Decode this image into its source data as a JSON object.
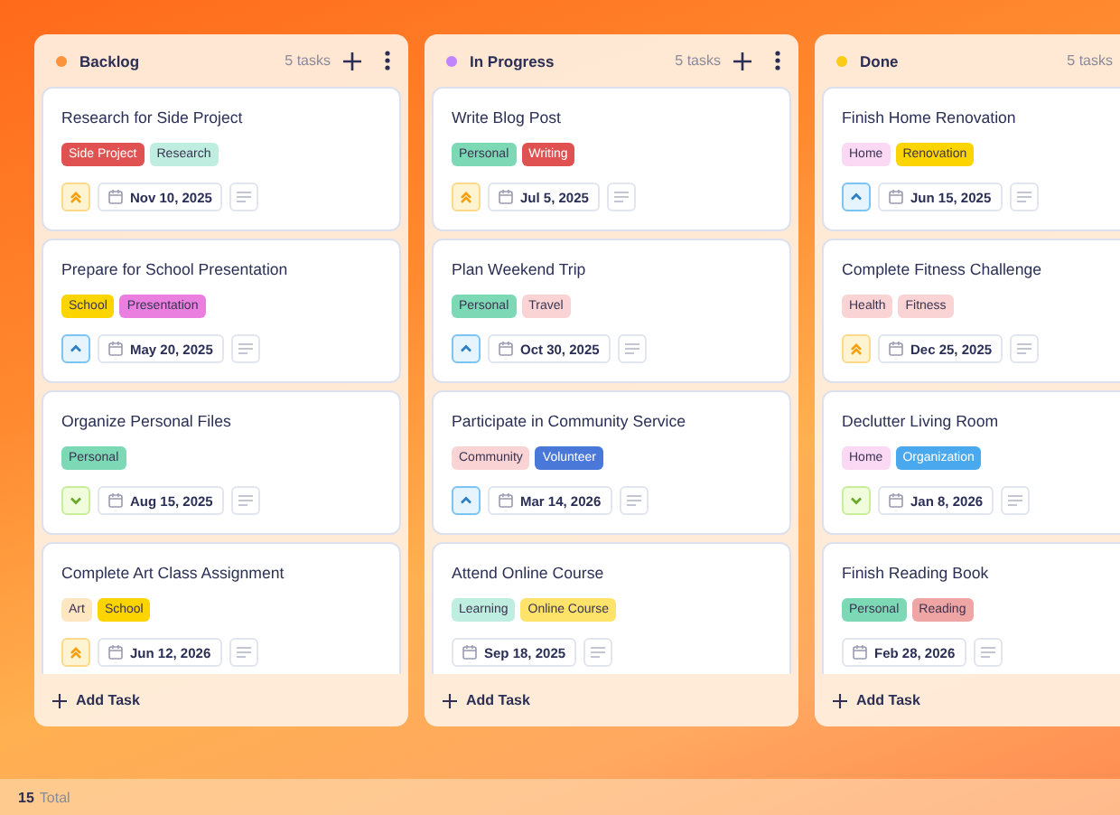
{
  "columns": [
    {
      "title": "Backlog",
      "color": "#fb923c",
      "count": "5 tasks",
      "actions": true,
      "cards": [
        {
          "title": "Research for Side Project",
          "tags": [
            {
              "label": "Side Project",
              "color": "#e05252"
            },
            {
              "label": "Research",
              "color": "#bfeee0"
            }
          ],
          "kind": "urgent",
          "date": "Nov 10, 2025"
        },
        {
          "title": "Prepare for School Presentation",
          "tags": [
            {
              "label": "School",
              "color": "#fcd400"
            },
            {
              "label": "Presentation",
              "color": "#ea7fe0"
            }
          ],
          "kind": "high",
          "date": "May 20, 2025"
        },
        {
          "title": "Organize Personal Files",
          "tags": [
            {
              "label": "Personal",
              "color": "#7dd9b5"
            }
          ],
          "kind": "low",
          "date": "Aug 15, 2025"
        },
        {
          "title": "Complete Art Class Assignment",
          "tags": [
            {
              "label": "Art",
              "color": "#ffe6c2"
            },
            {
              "label": "School",
              "color": "#fcd400"
            }
          ],
          "kind": "urgent",
          "date": "Jun 12, 2026"
        }
      ]
    },
    {
      "title": "In Progress",
      "color": "#c084fc",
      "count": "5 tasks",
      "actions": true,
      "cards": [
        {
          "title": "Write Blog Post",
          "tags": [
            {
              "label": "Personal",
              "color": "#7dd9b5"
            },
            {
              "label": "Writing",
              "color": "#e05252"
            }
          ],
          "kind": "urgent",
          "date": "Jul 5, 2025"
        },
        {
          "title": "Plan Weekend Trip",
          "tags": [
            {
              "label": "Personal",
              "color": "#7dd9b5"
            },
            {
              "label": "Travel",
              "color": "#fad4d4"
            }
          ],
          "kind": "high",
          "date": "Oct 30, 2025"
        },
        {
          "title": "Participate in Community Service",
          "tags": [
            {
              "label": "Community",
              "color": "#fad4d4"
            },
            {
              "label": "Volunteer",
              "color": "#4a78d9"
            }
          ],
          "kind": "high",
          "date": "Mar 14, 2026"
        },
        {
          "title": "Attend Online Course",
          "tags": [
            {
              "label": "Learning",
              "color": "#bfeee0"
            },
            {
              "label": "Online Course",
              "color": "#fde36a"
            }
          ],
          "date": "Sep 18, 2025"
        }
      ]
    },
    {
      "title": "Done",
      "color": "#facc15",
      "count": "5 tasks",
      "actions": false,
      "cards": [
        {
          "title": "Finish Home Renovation",
          "tags": [
            {
              "label": "Home",
              "color": "#fbd8f4"
            },
            {
              "label": "Renovation",
              "color": "#fcd400"
            }
          ],
          "kind": "high",
          "date": "Jun 15, 2025"
        },
        {
          "title": "Complete Fitness Challenge",
          "tags": [
            {
              "label": "Health",
              "color": "#fad4d4"
            },
            {
              "label": "Fitness",
              "color": "#fad4d4"
            }
          ],
          "kind": "urgent",
          "date": "Dec 25, 2025"
        },
        {
          "title": "Declutter Living Room",
          "tags": [
            {
              "label": "Home",
              "color": "#fbd8f4"
            },
            {
              "label": "Organization",
              "color": "#4aa8ee"
            }
          ],
          "kind": "low",
          "date": "Jan 8, 2026"
        },
        {
          "title": "Finish Reading Book",
          "tags": [
            {
              "label": "Personal",
              "color": "#7dd9b5"
            },
            {
              "label": "Reading",
              "color": "#f0a5a5"
            }
          ],
          "date": "Feb 28, 2026"
        }
      ]
    }
  ],
  "add_label": [
    "Add Task",
    "Add Task",
    "Add Task"
  ],
  "status_bar": {
    "count": "15",
    "label": "Total"
  }
}
